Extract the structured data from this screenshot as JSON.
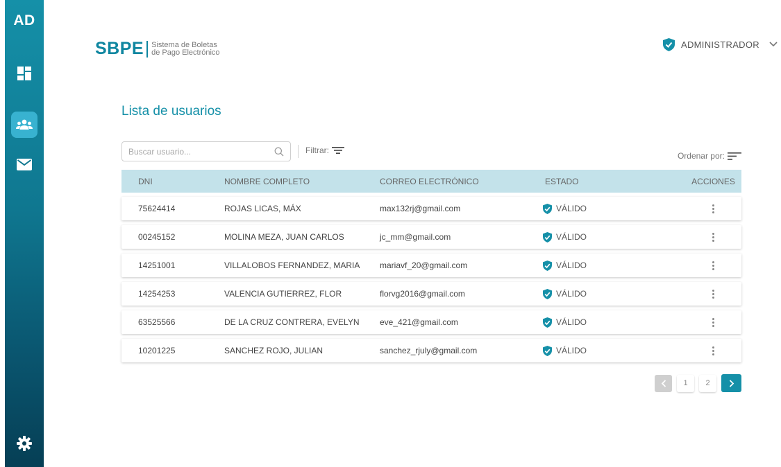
{
  "sidebar": {
    "logo": "AD",
    "items": [
      {
        "name": "dashboard-icon",
        "active": false
      },
      {
        "name": "users-icon",
        "active": true
      },
      {
        "name": "mail-icon",
        "active": false
      }
    ],
    "settings_icon": "gear-icon"
  },
  "header": {
    "brand": "SBPE",
    "subtitle_line1": "Sistema de Boletas",
    "subtitle_line2": "de Pago Electrónico",
    "user_role": "ADMINISTRADOR"
  },
  "page": {
    "title": "Lista de usuarios"
  },
  "toolbar": {
    "search_placeholder": "Buscar usuario...",
    "filter_label": "Filtrar:",
    "sort_label": "Ordenar por:"
  },
  "table": {
    "headers": {
      "dni": "DNI",
      "name": "NOMBRE COMPLETO",
      "email": "CORREO ELECTRÓNICO",
      "state": "ESTADO",
      "actions": "ACCIONES"
    },
    "rows": [
      {
        "dni": "75624414",
        "name": "ROJAS LICAS, MÁX",
        "email": "max132rj@gmail.com",
        "state": "VÁLIDO"
      },
      {
        "dni": "00245152",
        "name": "MOLINA MEZA, JUAN CARLOS",
        "email": "jc_mm@gmail.com",
        "state": "VÁLIDO"
      },
      {
        "dni": "14251001",
        "name": "VILLALOBOS FERNANDEZ, MARIA",
        "email": "mariavf_20@gmail.com",
        "state": "VÁLIDO"
      },
      {
        "dni": "14254253",
        "name": "VALENCIA GUTIERREZ, FLOR",
        "email": "florvg2016@gmail.com",
        "state": "VÁLIDO"
      },
      {
        "dni": "63525566",
        "name": "DE LA CRUZ CONTRERA, EVELYN",
        "email": "eve_421@gmail.com",
        "state": "VÁLIDO"
      },
      {
        "dni": "10201225",
        "name": "SANCHEZ ROJO, JULIAN",
        "email": "sanchez_rjuly@gmail.com",
        "state": "VÁLIDO"
      }
    ]
  },
  "pagination": {
    "pages": [
      "1",
      "2"
    ]
  },
  "colors": {
    "accent": "#1590a8",
    "header_row": "#c3e2ea",
    "active_nav": "#38b2d0"
  }
}
